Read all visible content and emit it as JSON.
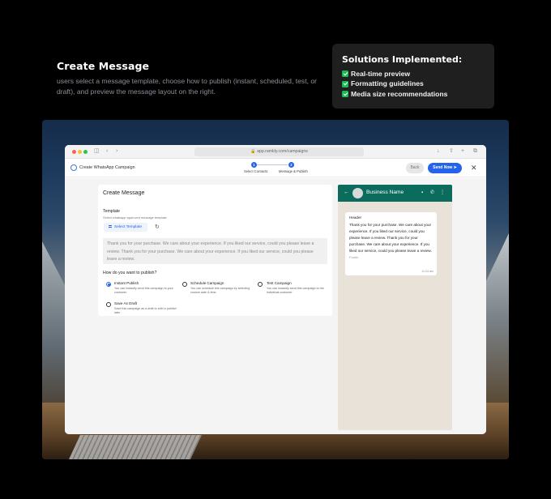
{
  "intro": {
    "title": "Create Message",
    "description": "users select a message template, choose how to publish (instant, scheduled, test, or draft), and preview the message layout on the right."
  },
  "solutions": {
    "title": "Solutions Implemented:",
    "items": [
      "Real-time preview",
      "Formatting guidelines",
      "Media size recommendations"
    ]
  },
  "browser": {
    "url": "app.ramkly.com/campaigns"
  },
  "app": {
    "title": "Create WhatsApp Campaign",
    "steps": [
      {
        "number": "1",
        "label": "Select Contacts"
      },
      {
        "number": "2",
        "label": "Message & Publish"
      }
    ],
    "back_label": "Back",
    "send_label": "Send Now"
  },
  "form": {
    "card_title": "Create Message",
    "template_label": "Template",
    "template_hint": "Select whatsapp approved message template",
    "select_template_label": "Select Template",
    "message_text": "Thank you for your purchase. We care about your experience. If you liked our service, could you please leave a review. Thank you for your purchase. We care about your experience. If you liked our service, could you please leave a review.",
    "publish_question": "How do you want to publish?",
    "options": [
      {
        "title": "Instant Publish",
        "desc": "You can instantly send this campaign to your customer",
        "selected": true
      },
      {
        "title": "Schedule Campaign",
        "desc": "You can schedule this campaign by selecting custom date & time",
        "selected": false
      },
      {
        "title": "Test Campaign",
        "desc": "You can instantly send this campaign to the individual customer",
        "selected": false
      },
      {
        "title": "Save As Draft",
        "desc": "Save this campaign as a draft to edit or publish later",
        "selected": false
      }
    ]
  },
  "preview": {
    "business_name": "Business Name",
    "header": "Header",
    "body": "Thank you for your purchase. We care about your experience. If you liked our service, could you please leave a review. Thank you for your purchase. We care about your experience. If you liked our service, could you please leave a review.",
    "footer": "Footer",
    "time": "11:24 am"
  },
  "colors": {
    "accent": "#2563eb",
    "whatsapp_header": "#0b6b5d",
    "chat_bg": "#e8e2d8",
    "check_green": "#1db954"
  }
}
